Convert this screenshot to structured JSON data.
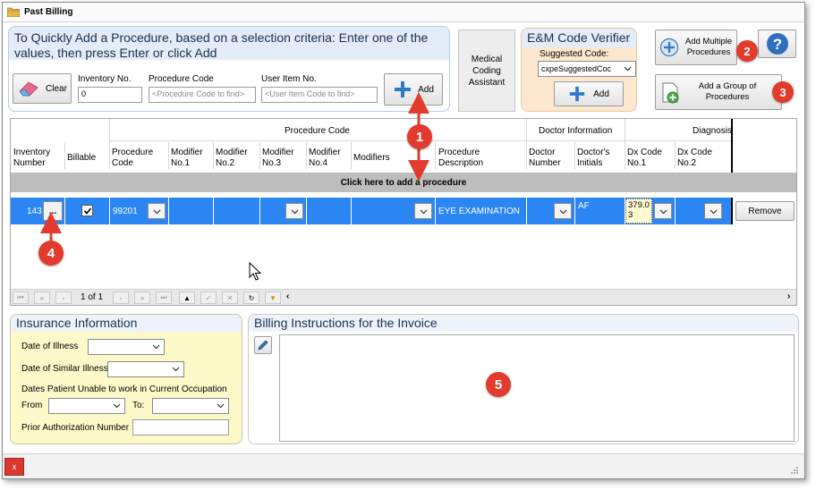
{
  "window": {
    "title": "Past Billing"
  },
  "quick_add": {
    "header": "To Quickly Add a Procedure, based on a selection criteria: Enter one of the values, then press Enter or click Add",
    "clear_label": "Clear",
    "inventory_label": "Inventory No.",
    "inventory_value": "0",
    "procedure_code_label": "Procedure Code",
    "procedure_code_placeholder": "<Procedure Code to find>",
    "user_item_label": "User Item No.",
    "user_item_placeholder": "<User Item Code to find>",
    "add_label": "Add"
  },
  "medical_coding": {
    "label": "Medical Coding Assistant"
  },
  "em_verifier": {
    "header": "E&M Code Verifier",
    "suggested_label": "Suggested Code:",
    "suggested_value": "cxpeSuggestedCoc",
    "add_label": "Add"
  },
  "buttons": {
    "add_multiple": "Add Multiple Procedures",
    "add_group": "Add a Group of Procedures",
    "help": "?"
  },
  "grid": {
    "group_headers": {
      "procedure_code": "Procedure Code",
      "doctor_info": "Doctor Information",
      "diagnosis": "Diagnosis"
    },
    "columns": {
      "inventory": "Inventory Number",
      "billable": "Billable",
      "procedure_code": "Procedure Code",
      "mod1": "Modifier No.1",
      "mod2": "Modifier No.2",
      "mod3": "Modifier No.3",
      "mod4": "Modifier No.4",
      "modifiers": "Modifiers",
      "description": "Procedure Description",
      "doctor_number": "Doctor Number",
      "doctor_initials": "Doctor's Initials",
      "dx1": "Dx Code No.1",
      "dx2": "Dx Code No.2"
    },
    "add_row_label": "Click here to add a procedure",
    "row": {
      "inventory": "143",
      "ellipsis": "...",
      "procedure_code": "99201",
      "description": "EYE EXAMINATION",
      "initials": "AF",
      "dx1": "379.0 3",
      "remove": "Remove"
    },
    "pager": {
      "page_text": "1 of 1"
    }
  },
  "insurance": {
    "header": "Insurance Information",
    "date_illness": "Date of Illness",
    "date_similar": "Date of Similar Illness",
    "unable_work": "Dates Patient Unable to work in Current Occupation",
    "from": "From",
    "to": "To:",
    "prior_auth": "Prior Authorization Number"
  },
  "billing": {
    "header": "Billing Instructions for the Invoice"
  },
  "statusbar": {
    "close": "x"
  },
  "annotations": [
    "1",
    "2",
    "3",
    "4",
    "5"
  ],
  "colors": {
    "selected_row": "#2b86f4",
    "badge": "#e23a2c",
    "accent_text": "#1b2f4d"
  }
}
